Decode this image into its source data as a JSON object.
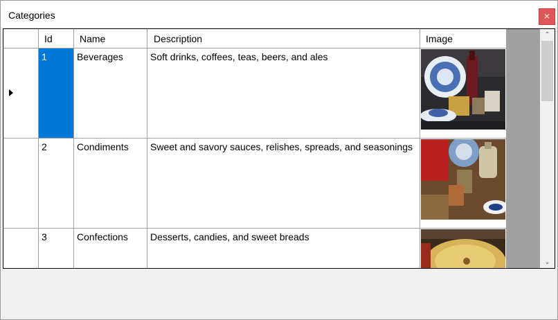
{
  "window": {
    "title": "Categories",
    "close_symbol": "×"
  },
  "grid": {
    "columns": [
      "Id",
      "Name",
      "Description",
      "Image"
    ],
    "rows": [
      {
        "id": "1",
        "name": "Beverages",
        "description": "Soft drinks, coffees, teas, beers, and ales",
        "image_icon": "beverages-photo"
      },
      {
        "id": "2",
        "name": "Condiments",
        "description": "Sweet and savory sauces, relishes, spreads, and seasonings",
        "image_icon": "condiments-photo"
      },
      {
        "id": "3",
        "name": "Confections",
        "description": "Desserts, candies, and sweet breads",
        "image_icon": "confections-photo"
      }
    ],
    "selected_row": 0
  },
  "scrollbar": {
    "up_symbol": "⌃",
    "down_symbol": "⌄"
  }
}
